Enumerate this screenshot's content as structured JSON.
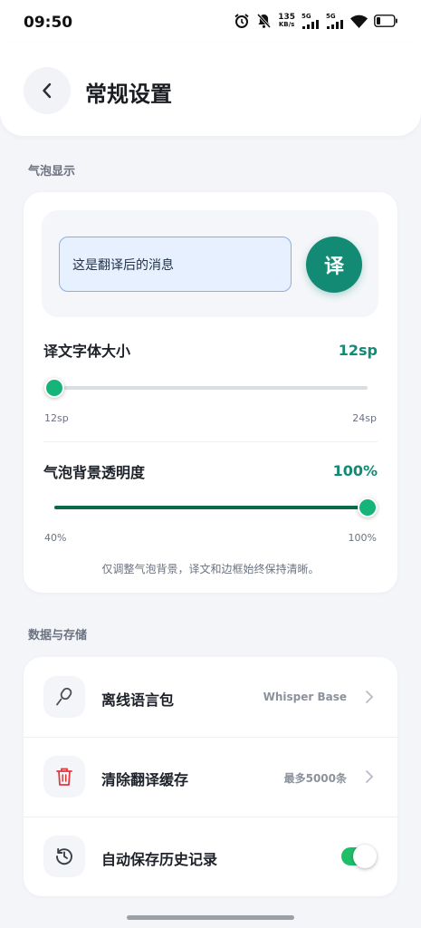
{
  "status_bar": {
    "time": "09:50",
    "net_speed_value": "135",
    "net_speed_unit": "KB/s",
    "signal1_label": "5G",
    "signal2_label": "5G",
    "icons": [
      "alarm-icon",
      "mute-bell-icon",
      "wifi-icon",
      "battery-icon"
    ]
  },
  "header": {
    "title": "常规设置",
    "back_icon": "chevron-left-icon"
  },
  "bubble_section": {
    "title": "气泡显示",
    "preview_text": "这是翻译后的消息",
    "fab_label": "译",
    "font_size": {
      "label": "译文字体大小",
      "value_text": "12sp",
      "min_label": "12sp",
      "max_label": "24sp",
      "level": 0.0
    },
    "opacity": {
      "label": "气泡背景透明度",
      "value_text": "100%",
      "min_label": "40%",
      "max_label": "100%",
      "level": 1.0
    },
    "note": "仅调整气泡背景，译文和边框始终保持清晰。"
  },
  "storage_section": {
    "title": "数据与存储",
    "rows": [
      {
        "label": "离线语言包",
        "value": "Whisper Base",
        "icon": "microphone-icon"
      },
      {
        "label": "清除翻译缓存",
        "value": "最多5000条",
        "icon": "trash-icon"
      },
      {
        "label": "自动保存历史记录",
        "icon": "history-icon",
        "toggle_on": true
      }
    ]
  },
  "colors": {
    "accent": "#138a74",
    "slider_fill": "#0b6b48",
    "toggle_on": "#1fbf6a",
    "danger": "#e0383e"
  }
}
